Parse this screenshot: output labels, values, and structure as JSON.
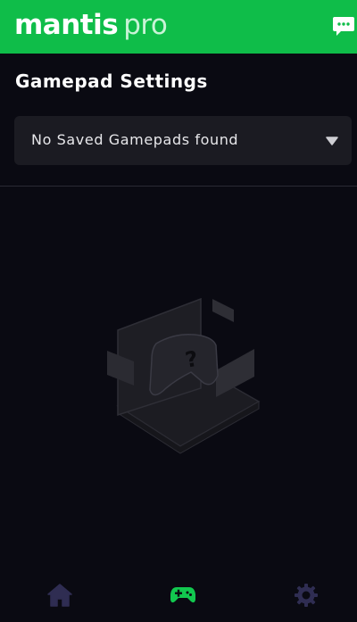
{
  "header": {
    "brand": "mantis",
    "brand_suffix": "pro",
    "accent_color": "#0fbd49",
    "chat_icon": "chat-bubble-icon"
  },
  "page": {
    "title": "Gamepad Settings"
  },
  "gamepad_select": {
    "selected": "No Saved Gamepads found",
    "icon": "caret-down-icon"
  },
  "empty_state": {
    "icon": "unknown-gamepad-illustration"
  },
  "nav": {
    "items": [
      {
        "icon": "home-icon",
        "active": false
      },
      {
        "icon": "gamepad-icon",
        "active": true
      },
      {
        "icon": "gear-icon",
        "active": false
      }
    ],
    "active_color": "#12c84f",
    "inactive_color": "#2f2d52"
  }
}
